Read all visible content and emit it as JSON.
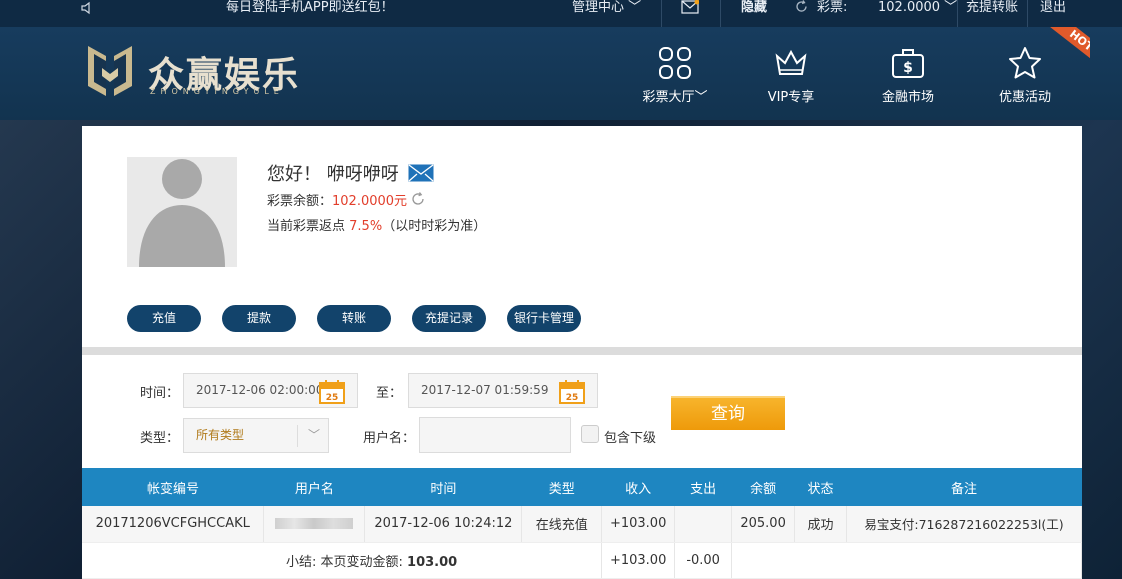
{
  "topbar": {
    "announcement": "每日登陆手机APP即送红包！",
    "manage": "管理中心",
    "hide": "隐藏",
    "lottery_label": "彩票:",
    "balance": "102.0000",
    "deposit_withdraw": "充提转账",
    "logout": "退出"
  },
  "logo": {
    "title": "众赢娱乐",
    "sub": "ZHONGYINGYULE"
  },
  "nav": [
    {
      "label": "彩票大厅",
      "icon": "grid-icon"
    },
    {
      "label": "VIP专享",
      "icon": "crown-icon"
    },
    {
      "label": "金融市场",
      "icon": "briefcase-dollar-icon"
    },
    {
      "label": "优惠活动",
      "icon": "star-icon"
    }
  ],
  "hot_badge": "HOT",
  "profile": {
    "greeting": "您好！ 咿呀咿呀",
    "balance_label": "彩票余额：",
    "balance_value": "102.0000元",
    "rebate_prefix": "当前彩票返点",
    "rebate_value": "7.5%",
    "rebate_suffix": "（以时时彩为准）"
  },
  "actions": [
    "充值",
    "提款",
    "转账",
    "充提记录",
    "银行卡管理"
  ],
  "filters": {
    "time_label": "时间：",
    "start_time": "2017-12-06 02:00:00",
    "to_label": "至：",
    "end_time": "2017-12-07 01:59:59",
    "calendar_day": "25",
    "type_label": "类型：",
    "type_value": "所有类型",
    "username_label": "用户名：",
    "username_value": "",
    "include_sub": "包含下级",
    "query": "查询"
  },
  "table": {
    "headers": [
      "帐变编号",
      "用户名",
      "时间",
      "类型",
      "收入",
      "支出",
      "余额",
      "状态",
      "备注"
    ],
    "rows": [
      [
        "20171206VCFGHCCAKL",
        "",
        "2017-12-06 10:24:12",
        "在线充值",
        "+103.00",
        "",
        "205.00",
        "成功",
        "易宝支付:716287216022253l(工)"
      ]
    ],
    "summary_label": "小结: 本页变动金额:",
    "summary_amount": "103.00",
    "summary_income": "+103.00",
    "summary_expense": "-0.00"
  },
  "colors": {
    "header_bg": "#12334f",
    "table_header": "#1e86c1",
    "button": "#12436b",
    "query": "#f0a019",
    "accent_red": "#e23e2b"
  }
}
